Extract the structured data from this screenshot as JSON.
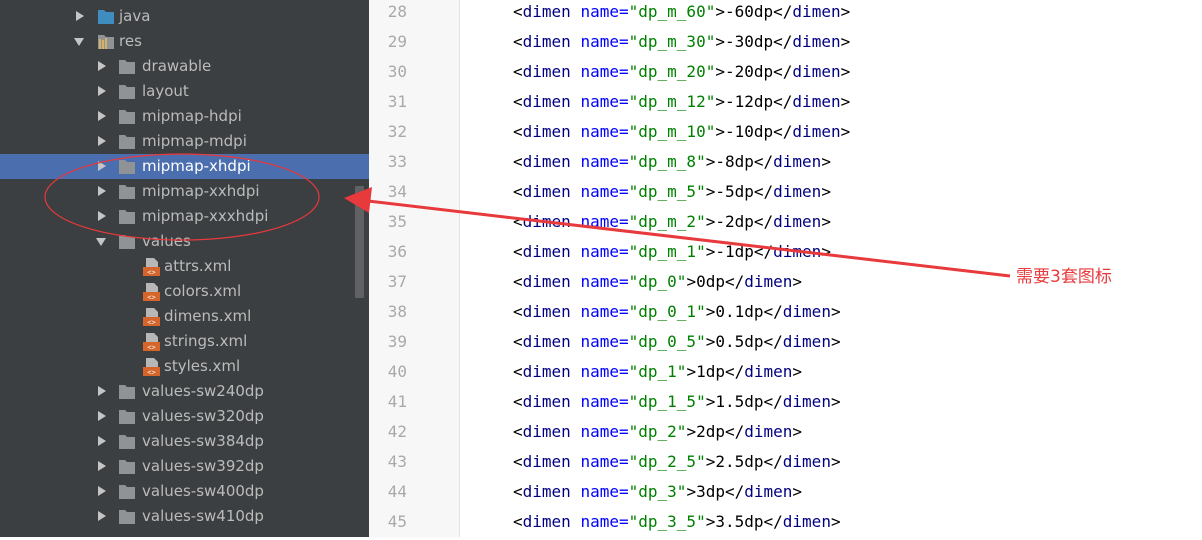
{
  "project_tree": {
    "items": [
      {
        "label": "java",
        "type": "folder",
        "depth": 1,
        "arrow": "right",
        "variant": "java"
      },
      {
        "label": "res",
        "type": "folder",
        "depth": 1,
        "arrow": "down",
        "variant": "res"
      },
      {
        "label": "drawable",
        "type": "folder",
        "depth": 2,
        "arrow": "right"
      },
      {
        "label": "layout",
        "type": "folder",
        "depth": 2,
        "arrow": "right"
      },
      {
        "label": "mipmap-hdpi",
        "type": "folder",
        "depth": 2,
        "arrow": "right"
      },
      {
        "label": "mipmap-mdpi",
        "type": "folder",
        "depth": 2,
        "arrow": "right"
      },
      {
        "label": "mipmap-xhdpi",
        "type": "folder",
        "depth": 2,
        "arrow": "right",
        "selected": true
      },
      {
        "label": "mipmap-xxhdpi",
        "type": "folder",
        "depth": 2,
        "arrow": "right"
      },
      {
        "label": "mipmap-xxxhdpi",
        "type": "folder",
        "depth": 2,
        "arrow": "right"
      },
      {
        "label": "values",
        "type": "folder",
        "depth": 2,
        "arrow": "down"
      },
      {
        "label": "attrs.xml",
        "type": "file",
        "depth": 3
      },
      {
        "label": "colors.xml",
        "type": "file",
        "depth": 3
      },
      {
        "label": "dimens.xml",
        "type": "file",
        "depth": 3
      },
      {
        "label": "strings.xml",
        "type": "file",
        "depth": 3
      },
      {
        "label": "styles.xml",
        "type": "file",
        "depth": 3
      },
      {
        "label": "values-sw240dp",
        "type": "folder",
        "depth": 2,
        "arrow": "right"
      },
      {
        "label": "values-sw320dp",
        "type": "folder",
        "depth": 2,
        "arrow": "right"
      },
      {
        "label": "values-sw384dp",
        "type": "folder",
        "depth": 2,
        "arrow": "right"
      },
      {
        "label": "values-sw392dp",
        "type": "folder",
        "depth": 2,
        "arrow": "right"
      },
      {
        "label": "values-sw400dp",
        "type": "folder",
        "depth": 2,
        "arrow": "right"
      },
      {
        "label": "values-sw410dp",
        "type": "folder",
        "depth": 2,
        "arrow": "right"
      }
    ]
  },
  "editor": {
    "lines": [
      {
        "num": "28",
        "name": "dp_m_60",
        "value": "-60dp"
      },
      {
        "num": "29",
        "name": "dp_m_30",
        "value": "-30dp"
      },
      {
        "num": "30",
        "name": "dp_m_20",
        "value": "-20dp"
      },
      {
        "num": "31",
        "name": "dp_m_12",
        "value": "-12dp"
      },
      {
        "num": "32",
        "name": "dp_m_10",
        "value": "-10dp"
      },
      {
        "num": "33",
        "name": "dp_m_8",
        "value": "-8dp"
      },
      {
        "num": "34",
        "name": "dp_m_5",
        "value": "-5dp"
      },
      {
        "num": "35",
        "name": "dp_m_2",
        "value": "-2dp"
      },
      {
        "num": "36",
        "name": "dp_m_1",
        "value": "-1dp"
      },
      {
        "num": "37",
        "name": "dp_0",
        "value": "0dp"
      },
      {
        "num": "38",
        "name": "dp_0_1",
        "value": "0.1dp"
      },
      {
        "num": "39",
        "name": "dp_0_5",
        "value": "0.5dp"
      },
      {
        "num": "40",
        "name": "dp_1",
        "value": "1dp"
      },
      {
        "num": "41",
        "name": "dp_1_5",
        "value": "1.5dp"
      },
      {
        "num": "42",
        "name": "dp_2",
        "value": "2dp"
      },
      {
        "num": "43",
        "name": "dp_2_5",
        "value": "2.5dp"
      },
      {
        "num": "44",
        "name": "dp_3",
        "value": "3dp"
      },
      {
        "num": "45",
        "name": "dp_3_5",
        "value": "3.5dp"
      }
    ]
  },
  "annotation": {
    "text": "需要3套图标",
    "color": "#e8393c"
  },
  "colors": {
    "tree_bg": "#3c3f41",
    "selection": "#4b6eaf",
    "folder": "#8f9396",
    "java_folder": "#3f8cc0",
    "xml_file": "#d5652a",
    "tag": "#000080",
    "attr": "#0000ff",
    "string": "#008000"
  }
}
